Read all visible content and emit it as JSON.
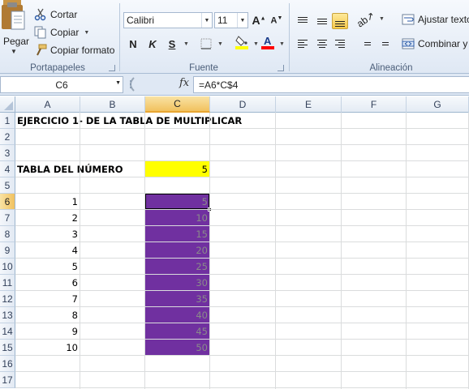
{
  "ribbon": {
    "clipboard": {
      "paste_label": "Pegar",
      "cut_label": "Cortar",
      "copy_label": "Copiar",
      "format_painter_label": "Copiar formato",
      "group_label": "Portapapeles"
    },
    "font": {
      "font_name": "Calibri",
      "font_size": "11",
      "bold_label": "N",
      "italic_label": "K",
      "underline_label": "S",
      "group_label": "Fuente",
      "fill_color": "#ffff00",
      "font_color": "#ff0000"
    },
    "alignment": {
      "wrap_text_label": "Ajustar texto",
      "merge_label": "Combinar y c",
      "group_label": "Alineación"
    }
  },
  "formula_bar": {
    "name_box": "C6",
    "fx_label": "fx",
    "formula": "=A6*C$4"
  },
  "sheet": {
    "columns": [
      "A",
      "B",
      "C",
      "D",
      "E",
      "F",
      "G"
    ],
    "rows": [
      "1",
      "2",
      "3",
      "4",
      "5",
      "6",
      "7",
      "8",
      "9",
      "10",
      "11",
      "12",
      "13",
      "14",
      "15",
      "16",
      "17"
    ],
    "selected_column": "C",
    "selected_row": "6",
    "cells": {
      "A1": "EJERCICIO 1- DE LA TABLA DE MULTIPLICAR",
      "A4": "TABLA DEL NÚMERO",
      "C4": "5",
      "A_values": [
        "1",
        "2",
        "3",
        "4",
        "5",
        "6",
        "7",
        "8",
        "9",
        "10"
      ],
      "C_values": [
        "5",
        "10",
        "15",
        "20",
        "25",
        "30",
        "35",
        "40",
        "45",
        "50"
      ]
    },
    "highlight_yellow": "#ffff00",
    "highlight_purple": "#7030a0"
  }
}
